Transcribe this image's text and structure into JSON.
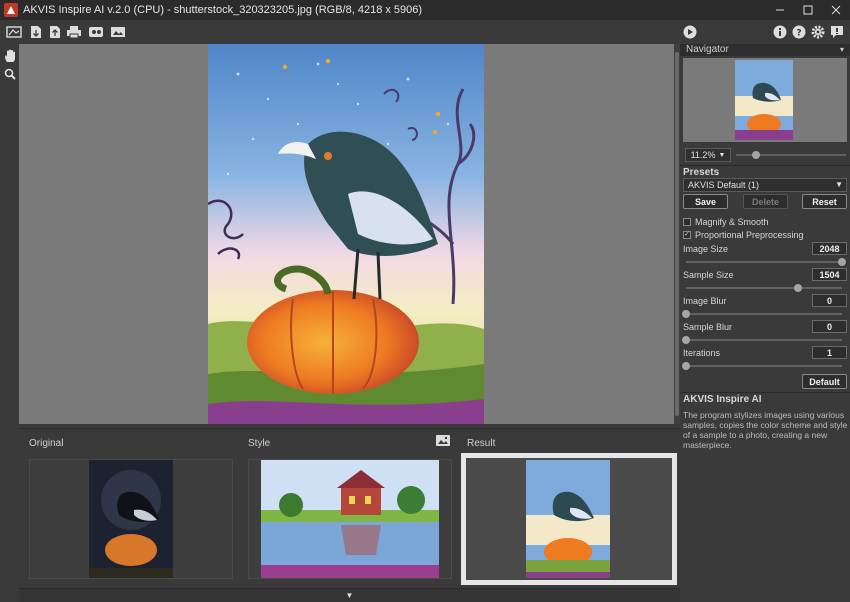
{
  "window": {
    "title": "AKVIS Inspire AI v.2.0 (CPU) - shutterstock_320323205.jpg (RGB/8, 4218 x 5906)"
  },
  "toolbar": {
    "icons": [
      "open-image-icon",
      "save-icon",
      "batch-save-icon",
      "print-icon",
      "share-icon",
      "style-gallery-icon"
    ],
    "right_icons": [
      "run-icon",
      "info-icon",
      "help-icon",
      "settings-icon",
      "news-icon"
    ]
  },
  "left_tools": [
    "hand-icon",
    "zoom-icon"
  ],
  "navigator": {
    "title": "Navigator",
    "zoom": "11.2%",
    "zoom_value": 0.3
  },
  "presets": {
    "title": "Presets",
    "selected": "AKVIS Default (1)",
    "save_label": "Save",
    "delete_label": "Delete",
    "reset_label": "Reset"
  },
  "options": {
    "magnify_label": "Magnify & Smooth",
    "magnify_checked": false,
    "proportional_label": "Proportional Preprocessing",
    "proportional_checked": true
  },
  "params": [
    {
      "label": "Image Size",
      "value": "2048",
      "level": 1.0
    },
    {
      "label": "Sample Size",
      "value": "1504",
      "level": 0.72
    },
    {
      "label": "Image Blur",
      "value": "0",
      "level": 0
    },
    {
      "label": "Sample Blur",
      "value": "0",
      "level": 0
    },
    {
      "label": "Iterations",
      "value": "1",
      "level": 0
    }
  ],
  "default_label": "Default",
  "about": {
    "title": "AKVIS Inspire AI",
    "text": "The program stylizes images using various samples, copies the color scheme and style of a sample to a photo, creating a new masterpiece."
  },
  "strip": {
    "original_label": "Original",
    "style_label": "Style",
    "result_label": "Result"
  },
  "colors": {
    "accent": "#c0392b",
    "panel": "#3a3a3a",
    "canvas_bg": "#7a7a7a"
  }
}
